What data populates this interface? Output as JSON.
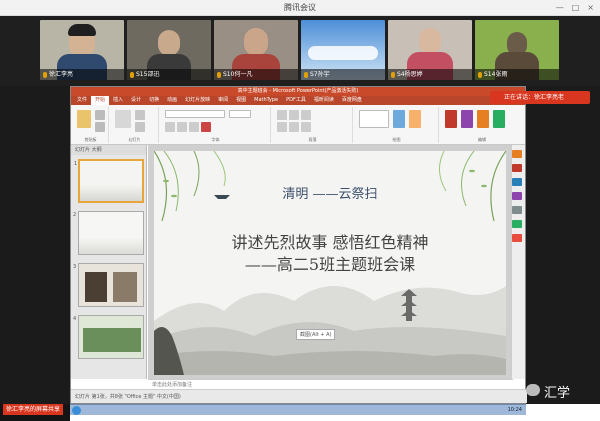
{
  "meeting": {
    "title": "腾讯会议",
    "window_controls": [
      "—",
      "□",
      "×"
    ]
  },
  "participants": [
    {
      "name": "徐汇李亮",
      "bg": "#b8b4a6",
      "icon": "mic-icon"
    },
    {
      "name": "S15邵迅",
      "bg": "#6f6a60",
      "icon": "mic-icon"
    },
    {
      "name": "S10何一凡",
      "bg": "#9a8f84",
      "icon": "mic-icon"
    },
    {
      "name": "S7孙宇",
      "bg": "#4d8fd8",
      "icon": "mic-icon"
    },
    {
      "name": "S4杨思婷",
      "bg": "#c8bfb6",
      "icon": "mic-icon"
    },
    {
      "name": "S14张雨",
      "bg": "#8ab04e",
      "icon": "mic-icon"
    }
  ],
  "red_pill": {
    "text": "正在讲话：徐汇李亮老"
  },
  "ppt": {
    "title": "高中主题班会 - Microsoft PowerPoint(产品激活失败)",
    "tabs": [
      "文件",
      "开始",
      "插入",
      "设计",
      "切换",
      "动画",
      "幻灯片放映",
      "审阅",
      "视图",
      "MathType",
      "PDF工具",
      "福昕阅读",
      "百度网盘"
    ],
    "active_tab": "开始",
    "ribbon_groups": [
      "剪贴板",
      "幻灯片",
      "字体",
      "段落",
      "绘图",
      "编辑"
    ],
    "thumb_tabs": "幻灯片  大纲",
    "thumb_numbers": [
      "1",
      "2",
      "3",
      "4"
    ],
    "notes": "单击此处添加备注",
    "status": "幻灯片 第1张，共8张  \"Office 主题\"  中文(中国)",
    "taskbar_clock": "10:24",
    "section_tag": "截图(Alt + A)"
  },
  "slide": {
    "heading": "清明   ——云祭扫",
    "line1": "讲述先烈故事  感悟红色精神",
    "line2": "——高二5班主题班会课"
  },
  "bottom": {
    "share_label": "徐汇李亮的屏幕共享",
    "watermark": "汇学"
  }
}
